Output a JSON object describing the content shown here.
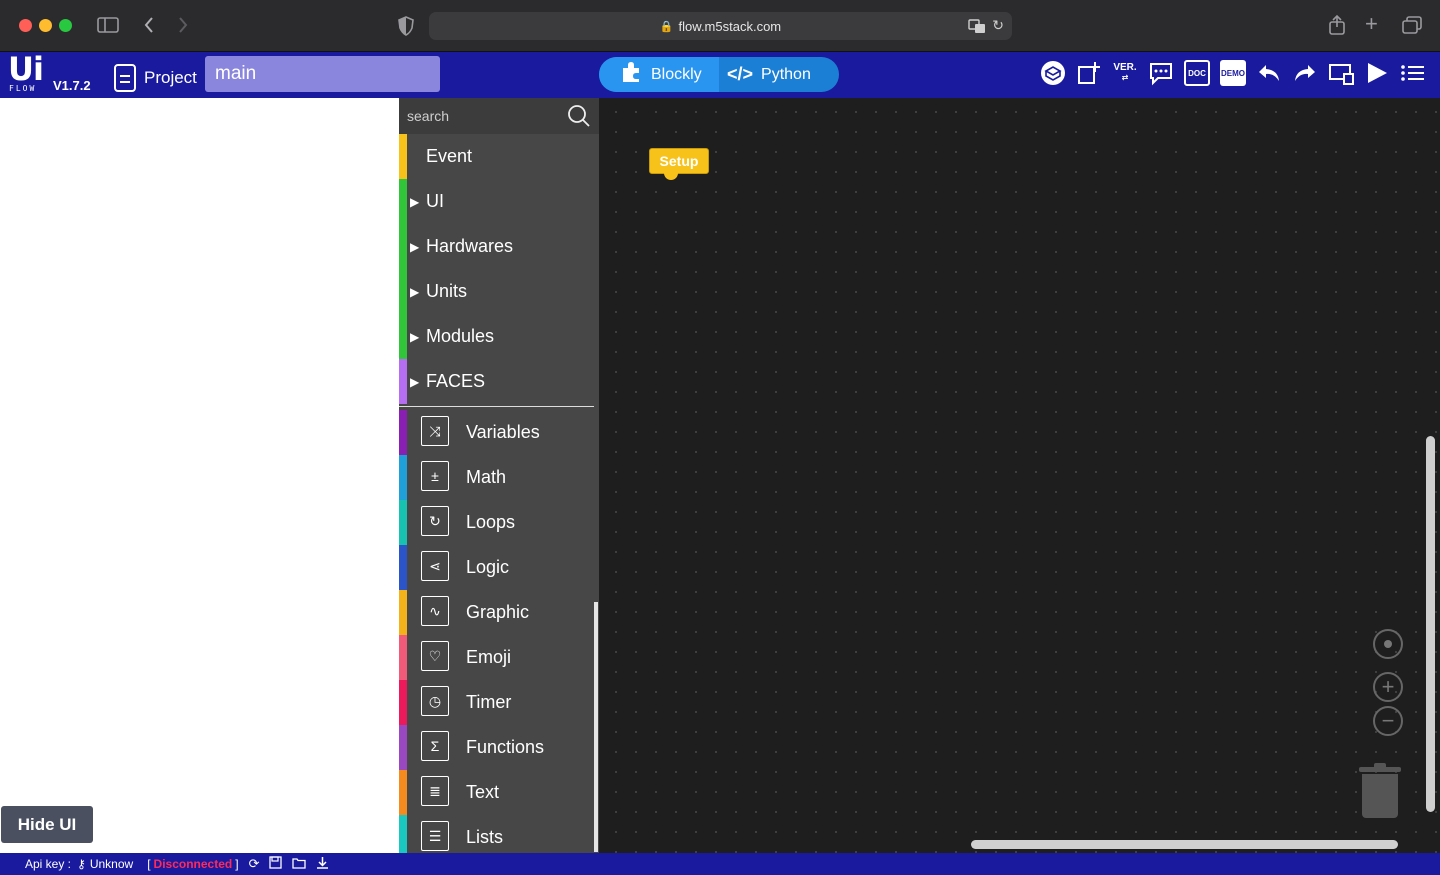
{
  "browser": {
    "url": "flow.m5stack.com"
  },
  "header": {
    "logo_main": "Ui",
    "logo_sub": "FLOW",
    "version": "V1.7.2",
    "project_label": "Project",
    "file_name": "main",
    "mode_blockly": "Blockly",
    "mode_python": "Python",
    "toolbar_icons": [
      "package-icon",
      "export-icon",
      "version-icon",
      "feedback-icon",
      "doc-icon",
      "demo-icon",
      "undo-icon",
      "redo-icon",
      "device-icon",
      "run-icon",
      "menu-icon"
    ],
    "doc_label": "DOC",
    "demo_label": "DEMO",
    "ver_label": "VER."
  },
  "ui_panel": {
    "hide_label": "Hide UI"
  },
  "toolbox": {
    "search_placeholder": "search",
    "categories": [
      {
        "label": "Event",
        "color": "#f7c21a",
        "expandable": false
      },
      {
        "label": "UI",
        "color": "#31c53a",
        "expandable": true
      },
      {
        "label": "Hardwares",
        "color": "#31c53a",
        "expandable": true
      },
      {
        "label": "Units",
        "color": "#31c53a",
        "expandable": true
      },
      {
        "label": "Modules",
        "color": "#31c53a",
        "expandable": true
      },
      {
        "label": "FACES",
        "color": "#b56ef2",
        "expandable": true
      }
    ],
    "builtins": [
      {
        "label": "Variables",
        "color": "#8a1fb3",
        "icon": "shuffle-icon"
      },
      {
        "label": "Math",
        "color": "#20a0d8",
        "icon": "math-icon"
      },
      {
        "label": "Loops",
        "color": "#17c2b0",
        "icon": "loop-icon"
      },
      {
        "label": "Logic",
        "color": "#2a54c7",
        "icon": "logic-icon"
      },
      {
        "label": "Graphic",
        "color": "#f3b21a",
        "icon": "graph-icon"
      },
      {
        "label": "Emoji",
        "color": "#f25a7a",
        "icon": "heart-icon"
      },
      {
        "label": "Timer",
        "color": "#ec1a5a",
        "icon": "clock-icon"
      },
      {
        "label": "Functions",
        "color": "#9a48c2",
        "icon": "sigma-icon"
      },
      {
        "label": "Text",
        "color": "#f58a1f",
        "icon": "text-icon"
      },
      {
        "label": "Lists",
        "color": "#1ac8c0",
        "icon": "list-icon"
      }
    ]
  },
  "workspace": {
    "setup_block": "Setup"
  },
  "status": {
    "api_key_label": "Api key :",
    "api_key_value": "Unknow",
    "connection": "Disconnected",
    "bracket_open": "[",
    "bracket_close": "]"
  }
}
